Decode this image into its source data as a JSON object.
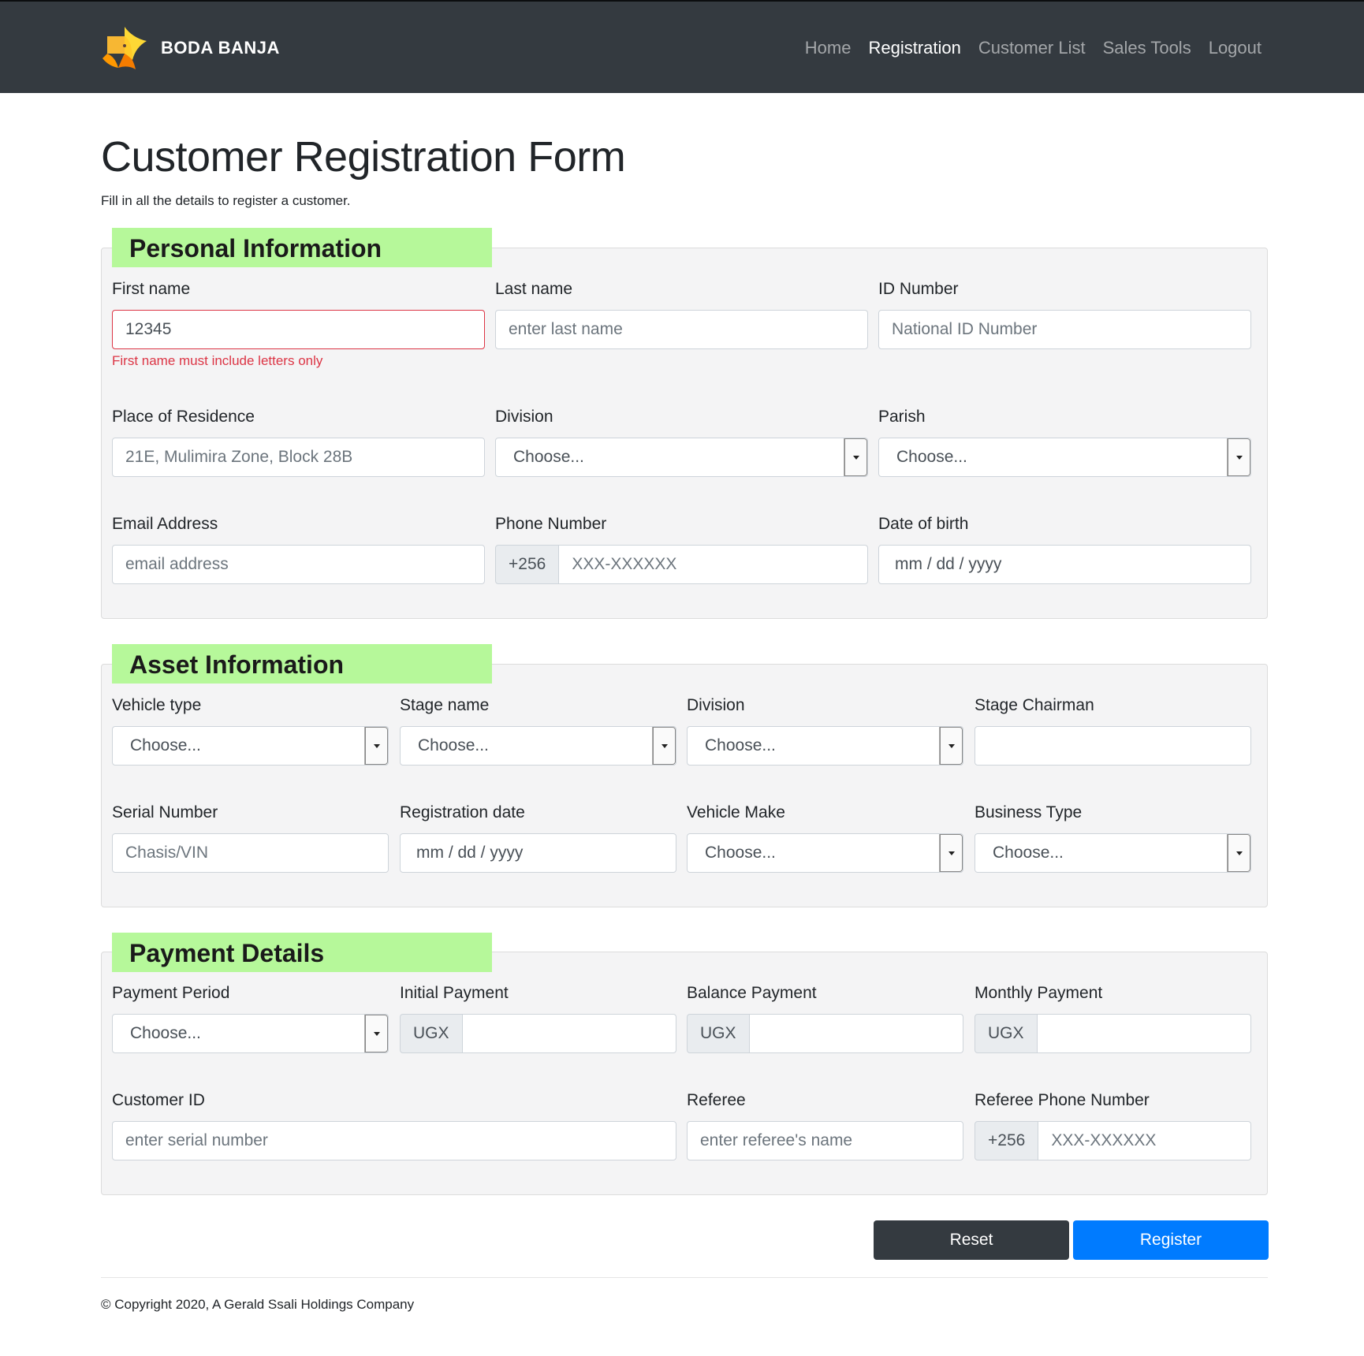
{
  "brand": {
    "name": "BODA BANJA"
  },
  "nav": {
    "items": [
      "Home",
      "Registration",
      "Customer List",
      "Sales Tools",
      "Logout"
    ],
    "active": "Registration"
  },
  "page": {
    "title": "Customer Registration Form",
    "subtitle": "Fill in all the details to register a customer."
  },
  "personal": {
    "legend": "Personal Information",
    "first_name": {
      "label": "First name",
      "value": "12345",
      "error": "First name must include letters only"
    },
    "last_name": {
      "label": "Last name",
      "placeholder": "enter last name"
    },
    "id_number": {
      "label": "ID Number",
      "placeholder": "National ID  Number"
    },
    "residence": {
      "label": "Place of Residence",
      "placeholder": "21E, Mulimira Zone, Block 28B"
    },
    "division": {
      "label": "Division",
      "value": "Choose..."
    },
    "parish": {
      "label": "Parish",
      "value": "Choose..."
    },
    "email": {
      "label": "Email Address",
      "placeholder": "email address"
    },
    "phone": {
      "label": "Phone Number",
      "prefix": "+256",
      "placeholder": "XXX-XXXXXX"
    },
    "dob": {
      "label": "Date of birth",
      "placeholder": "mm / dd / yyyy"
    }
  },
  "asset": {
    "legend": "Asset Information",
    "vehicle_type": {
      "label": "Vehicle type",
      "value": "Choose..."
    },
    "stage_name": {
      "label": "Stage name",
      "value": "Choose..."
    },
    "division": {
      "label": "Division",
      "value": "Choose..."
    },
    "stage_chairman": {
      "label": "Stage Chairman",
      "value": ""
    },
    "serial_number": {
      "label": "Serial Number",
      "placeholder": "Chasis/VIN"
    },
    "registration_date": {
      "label": "Registration date",
      "placeholder": "mm / dd / yyyy"
    },
    "vehicle_make": {
      "label": "Vehicle Make",
      "value": "Choose..."
    },
    "business_type": {
      "label": "Business Type",
      "value": "Choose..."
    }
  },
  "payment": {
    "legend": "Payment Details",
    "period": {
      "label": "Payment Period",
      "value": "Choose..."
    },
    "initial": {
      "label": "Initial Payment",
      "prefix": "UGX",
      "value": ""
    },
    "balance": {
      "label": "Balance Payment",
      "prefix": "UGX",
      "value": ""
    },
    "monthly": {
      "label": "Monthly Payment",
      "prefix": "UGX",
      "value": ""
    },
    "customer_id": {
      "label": "Customer ID",
      "placeholder": "enter serial number"
    },
    "referee": {
      "label": "Referee",
      "placeholder": "enter referee's name"
    },
    "referee_phone": {
      "label": "Referee Phone Number",
      "prefix": "+256",
      "placeholder": "XXX-XXXXXX"
    }
  },
  "actions": {
    "reset": "Reset",
    "register": "Register"
  },
  "footer": {
    "text": "© Copyright 2020, A Gerald Ssali Holdings Company"
  },
  "colors": {
    "navbar": "#343a40",
    "legend_bg": "#b6f89a",
    "primary": "#007bff",
    "error": "#dc3545"
  }
}
